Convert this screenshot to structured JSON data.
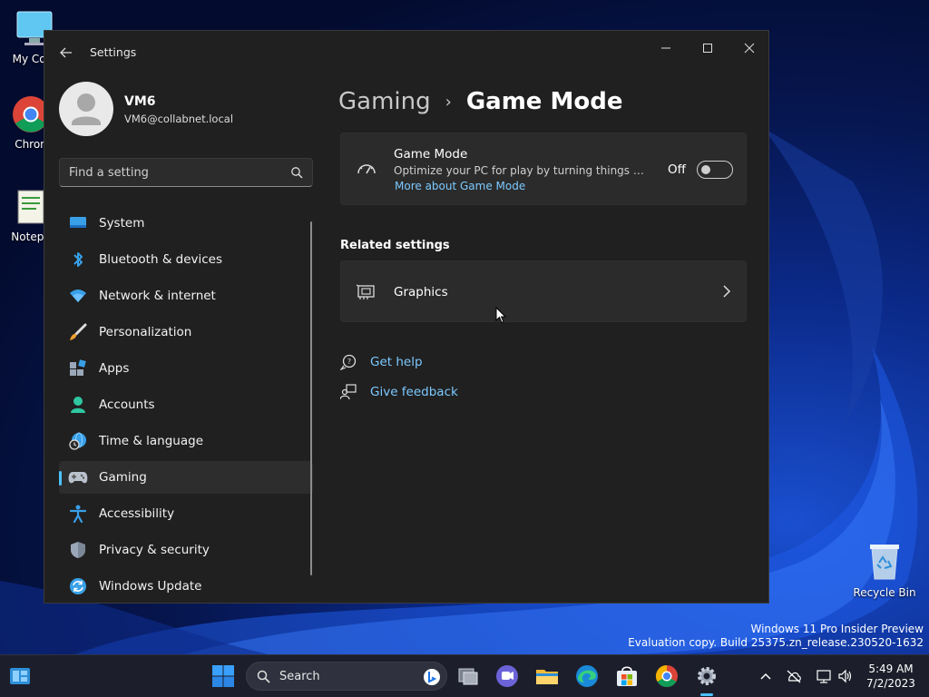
{
  "desktop": {
    "icons": [
      {
        "label": "My Com"
      },
      {
        "label": "Chron"
      },
      {
        "label": "Notepa"
      }
    ],
    "recycle_bin": "Recycle Bin",
    "watermark_line1": "Windows 11 Pro Insider Preview",
    "watermark_line2": "Evaluation copy. Build 25375.zn_release.230520-1632"
  },
  "window": {
    "title": "Settings",
    "controls": {
      "minimize": "—",
      "maximize": "☐",
      "close": "✕"
    }
  },
  "profile": {
    "name": "VM6",
    "email": "VM6@collabnet.local"
  },
  "search": {
    "placeholder": "Find a setting"
  },
  "sidebar": {
    "items": [
      {
        "label": "System",
        "icon": "system-icon"
      },
      {
        "label": "Bluetooth & devices",
        "icon": "bluetooth-icon"
      },
      {
        "label": "Network & internet",
        "icon": "wifi-icon"
      },
      {
        "label": "Personalization",
        "icon": "brush-icon"
      },
      {
        "label": "Apps",
        "icon": "apps-icon"
      },
      {
        "label": "Accounts",
        "icon": "person-icon"
      },
      {
        "label": "Time & language",
        "icon": "globe-clock-icon"
      },
      {
        "label": "Gaming",
        "icon": "gamepad-icon",
        "active": true
      },
      {
        "label": "Accessibility",
        "icon": "accessibility-icon"
      },
      {
        "label": "Privacy & security",
        "icon": "shield-icon"
      },
      {
        "label": "Windows Update",
        "icon": "update-icon"
      }
    ]
  },
  "breadcrumb": {
    "parent": "Gaming",
    "separator": "›",
    "current": "Game Mode"
  },
  "game_mode": {
    "title": "Game Mode",
    "description": "Optimize your PC for play by turning things off in...",
    "link": "More about Game Mode",
    "state_label": "Off",
    "enabled": false
  },
  "related": {
    "heading": "Related settings",
    "graphics_label": "Graphics"
  },
  "help": {
    "get_help": "Get help",
    "give_feedback": "Give feedback"
  },
  "taskbar": {
    "search_label": "Search",
    "time": "5:49 AM",
    "date": "7/2/2023"
  },
  "colors": {
    "accent": "#4cc2ff",
    "link": "#7cc9ff",
    "window_bg": "#202020",
    "card_bg": "#2b2b2b"
  }
}
